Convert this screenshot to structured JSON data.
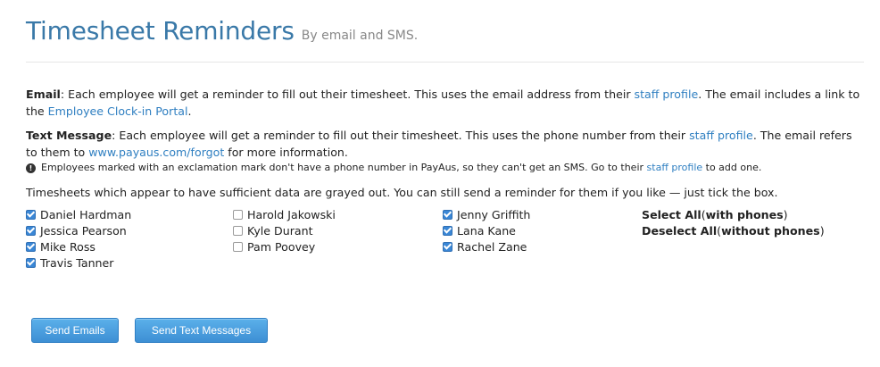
{
  "header": {
    "title": "Timesheet Reminders",
    "subtitle": "By email and SMS."
  },
  "email_section": {
    "label": "Email",
    "text1": ": Each employee will get a reminder to fill out their timesheet. This uses the email address from their ",
    "link1": "staff profile",
    "text2": ". The email includes a link to the ",
    "link2": "Employee Clock-in Portal",
    "text3": "."
  },
  "sms_section": {
    "label": "Text Message",
    "text1": ": Each employee will get a reminder to fill out their timesheet. This uses the phone number from their ",
    "link1": "staff profile",
    "text2": ". The email refers to them to ",
    "link2": "www.payaus.com/forgot",
    "text3": " for more information.",
    "note_icon": "exclamation-icon",
    "note_text": "Employees marked with an exclamation mark don't have a phone number in PayAus, so they can't get an SMS. Go to their ",
    "note_link": "staff profile",
    "note_text2": " to add one."
  },
  "grayed_intro": "Timesheets which appear to have sufficient data are grayed out. You can still send a reminder for them if you like — just tick the box.",
  "staff": {
    "column1": [
      {
        "name": "Daniel Hardman",
        "checked": true
      },
      {
        "name": "Jessica Pearson",
        "checked": true
      },
      {
        "name": "Mike Ross",
        "checked": true
      },
      {
        "name": "Travis Tanner",
        "checked": true
      }
    ],
    "column2": [
      {
        "name": "Harold Jakowski",
        "checked": false
      },
      {
        "name": "Kyle Durant",
        "checked": false
      },
      {
        "name": "Pam Poovey",
        "checked": false
      }
    ],
    "column3": [
      {
        "name": "Jenny Griffith",
        "checked": true
      },
      {
        "name": "Lana Kane",
        "checked": true
      },
      {
        "name": "Rachel Zane",
        "checked": true
      }
    ]
  },
  "select_links": {
    "select_all": "Select All",
    "select_all_qualifier_open": " (",
    "select_all_with": "with phones",
    "select_all_close": ")",
    "deselect_all": "Deselect All",
    "deselect_all_qualifier_open": " (",
    "deselect_all_without": "without phones",
    "deselect_all_close": ")"
  },
  "buttons": {
    "send_emails": "Send Emails",
    "send_texts": "Send Text Messages"
  },
  "colors": {
    "title": "#3a79a8",
    "link": "#2f7fc1",
    "button": "#4a9de0"
  }
}
